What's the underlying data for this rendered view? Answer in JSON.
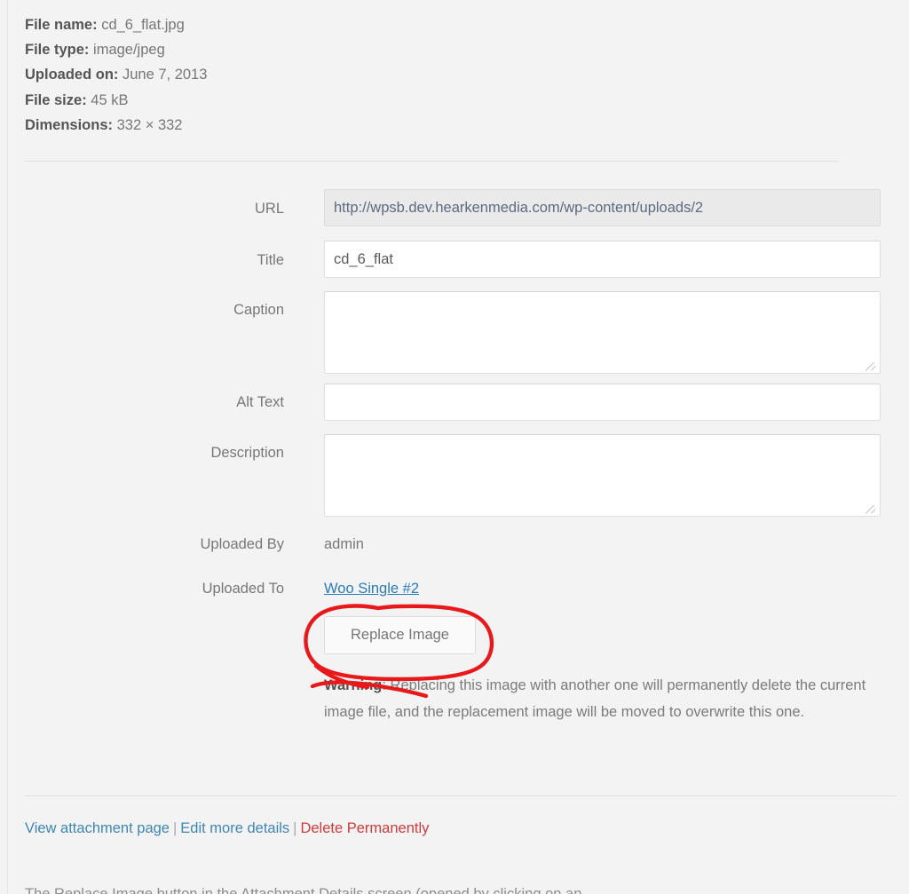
{
  "metadata": [
    {
      "key": "File name:",
      "value": "cd_6_flat.jpg"
    },
    {
      "key": "File type:",
      "value": "image/jpeg"
    },
    {
      "key": "Uploaded on:",
      "value": "June 7, 2013"
    },
    {
      "key": "File size:",
      "value": "45 kB"
    },
    {
      "key": "Dimensions:",
      "value": "332 × 332"
    }
  ],
  "form": {
    "url": {
      "label": "URL",
      "value": "http://wpsb.dev.hearkenmedia.com/wp-content/uploads/2"
    },
    "title": {
      "label": "Title",
      "value": "cd_6_flat"
    },
    "caption": {
      "label": "Caption",
      "value": ""
    },
    "alt_text": {
      "label": "Alt Text",
      "value": ""
    },
    "description": {
      "label": "Description",
      "value": ""
    },
    "uploaded_by": {
      "label": "Uploaded By",
      "value": "admin"
    },
    "uploaded_to": {
      "label": "Uploaded To",
      "value": "Woo Single #2"
    }
  },
  "actions": {
    "replace_image_label": "Replace Image"
  },
  "warning": {
    "prefix": "Warning",
    "text": ": Replacing this image with another one will permanently delete the current image file, and the replacement image will be moved to overwrite this one."
  },
  "bottom_links": {
    "view": "View attachment page",
    "edit": "Edit more details",
    "delete": "Delete Permanently",
    "separator": "|"
  },
  "clipped_caption": "The Replace Image button in the Attachment Details screen (opened by clicking on an",
  "colors": {
    "background": "#f3f3f4",
    "link": "#3f86b0",
    "danger": "#cc3b3b",
    "annotation": "#e8191b",
    "label_text": "#777777"
  }
}
